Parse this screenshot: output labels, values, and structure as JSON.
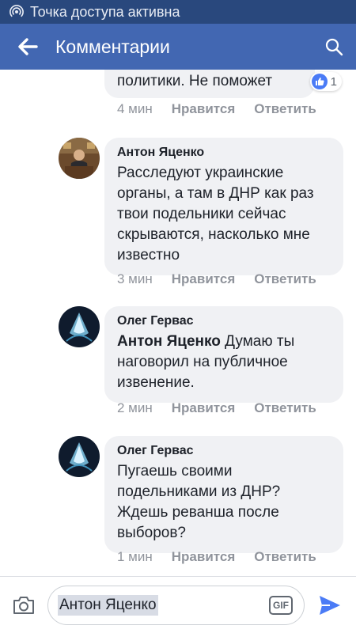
{
  "status_bar": {
    "text": "Точка доступа активна"
  },
  "header": {
    "title": "Комментарии"
  },
  "comments": [
    {
      "text_visible": "политики. Не поможет",
      "time": "4 мин",
      "like_label": "Нравится",
      "reply_label": "Ответить",
      "reaction_count": "1"
    },
    {
      "author": "Антон Яценко",
      "text": "Расследуют украинские органы, а там в ДНР как раз твои подельники сейчас скрываются, насколько мне известно",
      "time": "3 мин",
      "like_label": "Нравится",
      "reply_label": "Ответить"
    },
    {
      "author": "Олег Гервас",
      "mention": "Антон Яценко",
      "text": "Думаю ты наговорил на публичное извенение.",
      "time": "2 мин",
      "like_label": "Нравится",
      "reply_label": "Ответить"
    },
    {
      "author": "Олег Гервас",
      "text": "Пугаешь своими подельниками из ДНР? Ждешь реванша после выборов?",
      "time": "1 мин",
      "like_label": "Нравится",
      "reply_label": "Ответить"
    }
  ],
  "composer": {
    "input_value": "Антон Яценко",
    "gif_label": "GIF"
  },
  "icons": {
    "status": "hotspot-icon",
    "back": "back-arrow-icon",
    "search": "search-icon",
    "camera": "camera-icon",
    "send": "send-icon",
    "like": "like-icon"
  },
  "colors": {
    "status_bar": "#29487d",
    "app_bar": "#4267b2",
    "bubble": "#f0f1f4",
    "send": "#4a7bf6"
  }
}
